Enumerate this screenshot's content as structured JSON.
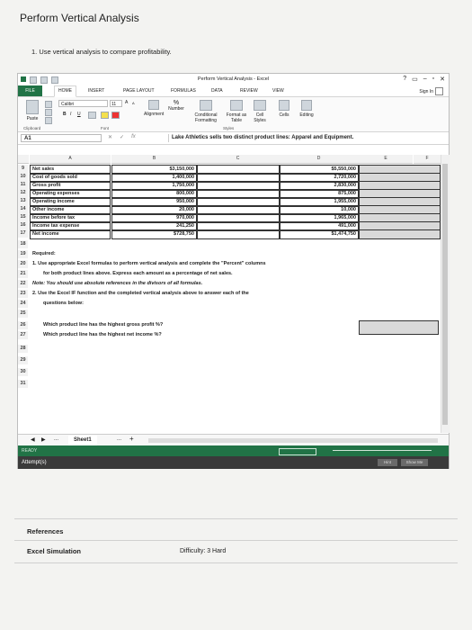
{
  "page": {
    "title": "Perform Vertical Analysis",
    "question": "1. Use vertical analysis to compare profitability."
  },
  "window": {
    "title": "Perform Vertical Analysis - Excel",
    "controls": [
      "?",
      "▭",
      "–",
      "▫",
      "✕"
    ]
  },
  "ribbon": {
    "tabs": [
      "FILE",
      "HOME",
      "INSERT",
      "PAGE LAYOUT",
      "FORMULAS",
      "DATA",
      "REVIEW",
      "VIEW"
    ],
    "active_tab": "HOME",
    "sign_in": "Sign In",
    "font_name": "Calibri",
    "font_size": "11",
    "paste": "Paste",
    "clipboard": "Clipboard",
    "font_group": "Font",
    "alignment": "Alignment",
    "number": "Number",
    "percent": "%",
    "conditional": "Conditional Formatting",
    "format_table": "Format as Table",
    "cell_styles": "Cell Styles",
    "cells": "Cells",
    "editing": "Editing",
    "styles_group": "Styles",
    "bold": "B",
    "italic": "I",
    "underline": "U",
    "grow": "A",
    "shrink": "A"
  },
  "formula_bar": {
    "name_box": "A1",
    "fx": "fx",
    "content": "Lake Athletics sells two distinct product lines: Apparel and Equipment."
  },
  "columns": [
    "A",
    "B",
    "C",
    "D",
    "E",
    "F"
  ],
  "table": {
    "rows": [
      {
        "num": "9",
        "label": "Net sales",
        "b": "$3,150,000",
        "d": "$5,550,000"
      },
      {
        "num": "10",
        "label": "Cost of goods sold",
        "b": "1,400,000",
        "d": "2,720,000"
      },
      {
        "num": "11",
        "label": "Gross profit",
        "b": "1,750,000",
        "d": "2,830,000"
      },
      {
        "num": "12",
        "label": "Operating expenses",
        "b": "800,000",
        "d": "875,000"
      },
      {
        "num": "13",
        "label": "Operating income",
        "b": "950,000",
        "d": "1,955,000"
      },
      {
        "num": "14",
        "label": "Other income",
        "b": "20,000",
        "d": "10,000"
      },
      {
        "num": "15",
        "label": "Income before tax",
        "b": "970,000",
        "d": "1,965,000"
      },
      {
        "num": "16",
        "label": "Income tax expense",
        "b": "241,250",
        "d": "491,000"
      },
      {
        "num": "17",
        "label": "Net income",
        "b": "$728,750",
        "d": "$1,474,750"
      }
    ]
  },
  "instructions": {
    "r18": "18",
    "r19": "19",
    "t19": "Required:",
    "r20": "20",
    "t20": "1. Use appropriate Excel formulas to perform vertical analysis and complete the \"Percent\" columns",
    "r21": "21",
    "t21": "for both product lines above. Express each amount as a percentage of net sales.",
    "r22": "22",
    "t22": "Note: You should use absolute references in the divisors of all formulas.",
    "r23": "23",
    "t23": "2. Use the Excel IF function and the completed vertical analysis above to answer each of the",
    "r24": "24",
    "t24": "questions below:",
    "r25": "25",
    "r26": "26",
    "t26": "Which product line has the highest gross profit %?",
    "r27": "27",
    "t27": "Which product line has the highest net income %?",
    "r28": "28",
    "r29": "29",
    "r30": "30",
    "r31": "31"
  },
  "sheet": {
    "tab": "Sheet1",
    "nav_prev": "◀",
    "nav_next": "▶",
    "more": "...",
    "add": "+"
  },
  "status": {
    "ready": "READY"
  },
  "attempt": {
    "label": "Attempt(s)",
    "hint": "Hint",
    "show_me": "Show Me"
  },
  "footer": {
    "references": "References",
    "type": "Excel Simulation",
    "difficulty": "Difficulty: 3 Hard"
  }
}
